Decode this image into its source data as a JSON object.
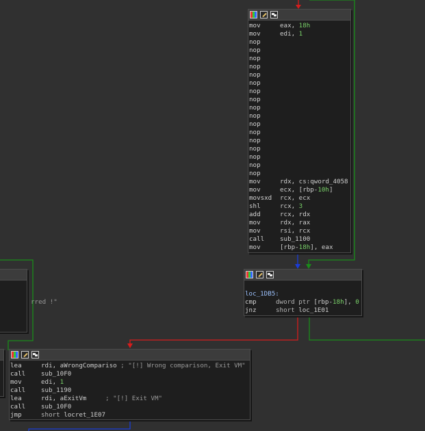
{
  "node_top": {
    "lines": [
      {
        "m": "mov",
        "o": [
          {
            "t": "eax, ",
            "c": "reg"
          },
          {
            "t": "18h",
            "c": "num"
          }
        ]
      },
      {
        "m": "mov",
        "o": [
          {
            "t": "edi, ",
            "c": "reg"
          },
          {
            "t": "1",
            "c": "num"
          }
        ]
      },
      {
        "m": "nop",
        "o": []
      },
      {
        "m": "nop",
        "o": []
      },
      {
        "m": "nop",
        "o": []
      },
      {
        "m": "nop",
        "o": []
      },
      {
        "m": "nop",
        "o": []
      },
      {
        "m": "nop",
        "o": []
      },
      {
        "m": "nop",
        "o": []
      },
      {
        "m": "nop",
        "o": []
      },
      {
        "m": "nop",
        "o": []
      },
      {
        "m": "nop",
        "o": []
      },
      {
        "m": "nop",
        "o": []
      },
      {
        "m": "nop",
        "o": []
      },
      {
        "m": "nop",
        "o": []
      },
      {
        "m": "nop",
        "o": []
      },
      {
        "m": "nop",
        "o": []
      },
      {
        "m": "nop",
        "o": []
      },
      {
        "m": "nop",
        "o": []
      },
      {
        "m": "mov",
        "o": [
          {
            "t": "rdx, cs:qword_4058",
            "c": "reg"
          }
        ]
      },
      {
        "m": "mov",
        "o": [
          {
            "t": "ecx, [rbp-",
            "c": "reg"
          },
          {
            "t": "10h",
            "c": "num"
          },
          {
            "t": "]",
            "c": "reg"
          }
        ]
      },
      {
        "m": "movsxd",
        "o": [
          {
            "t": "rcx, ecx",
            "c": "reg"
          }
        ]
      },
      {
        "m": "shl",
        "o": [
          {
            "t": "rcx, ",
            "c": "reg"
          },
          {
            "t": "3",
            "c": "num"
          }
        ]
      },
      {
        "m": "add",
        "o": [
          {
            "t": "rcx, rdx",
            "c": "reg"
          }
        ]
      },
      {
        "m": "mov",
        "o": [
          {
            "t": "rdx, rax",
            "c": "reg"
          }
        ]
      },
      {
        "m": "mov",
        "o": [
          {
            "t": "rsi, rcx",
            "c": "reg"
          }
        ]
      },
      {
        "m": "call",
        "o": [
          {
            "t": "sub_1100",
            "c": "reg"
          }
        ]
      },
      {
        "m": "mov",
        "o": [
          {
            "t": "[rbp-",
            "c": "reg"
          },
          {
            "t": "18h",
            "c": "num"
          },
          {
            "t": "], eax",
            "c": "reg"
          }
        ]
      }
    ]
  },
  "node_mid": {
    "lines": [
      {
        "m": "",
        "o": []
      },
      {
        "m": "loc_1DB5:",
        "o": [],
        "label": true
      },
      {
        "m": "cmp",
        "o": [
          {
            "t": "dword ptr ",
            "c": "kw"
          },
          {
            "t": "[rbp-",
            "c": "reg"
          },
          {
            "t": "18h",
            "c": "num"
          },
          {
            "t": "], ",
            "c": "reg"
          },
          {
            "t": "0",
            "c": "num"
          }
        ]
      },
      {
        "m": "jnz",
        "o": [
          {
            "t": "short ",
            "c": "kw"
          },
          {
            "t": "loc_1E01",
            "c": "reg"
          }
        ]
      }
    ]
  },
  "node_left": {
    "lines": [
      {
        "m": "",
        "o": []
      },
      {
        "m": "",
        "o": []
      },
      {
        "m": "",
        "o": [
          {
            "t": "rred !\"",
            "c": "cmt"
          }
        ]
      }
    ]
  },
  "node_bottom": {
    "lines": [
      {
        "m": "lea",
        "o": [
          {
            "t": "rdi, aWrongCompariso ",
            "c": "reg"
          },
          {
            "t": "; \"[!] Wrong comparison, Exit VM\"",
            "c": "cmt"
          }
        ]
      },
      {
        "m": "call",
        "o": [
          {
            "t": "sub_10F0",
            "c": "reg"
          }
        ]
      },
      {
        "m": "mov",
        "o": [
          {
            "t": "edi, ",
            "c": "reg"
          },
          {
            "t": "1",
            "c": "num"
          }
        ]
      },
      {
        "m": "call",
        "o": [
          {
            "t": "sub_1190",
            "c": "reg"
          }
        ]
      },
      {
        "m": "lea",
        "o": [
          {
            "t": "rdi, aExitVm     ",
            "c": "reg"
          },
          {
            "t": "; \"[!] Exit VM\"",
            "c": "cmt"
          }
        ]
      },
      {
        "m": "call",
        "o": [
          {
            "t": "sub_10F0",
            "c": "reg"
          }
        ]
      },
      {
        "m": "jmp",
        "o": [
          {
            "t": "short ",
            "c": "kw"
          },
          {
            "t": "locret_1E07",
            "c": "reg"
          }
        ]
      }
    ]
  },
  "edge_colors": {
    "true_branch": "#1a8c1a",
    "false_branch": "#d81c1c",
    "unconditional": "#1a3cd8"
  }
}
